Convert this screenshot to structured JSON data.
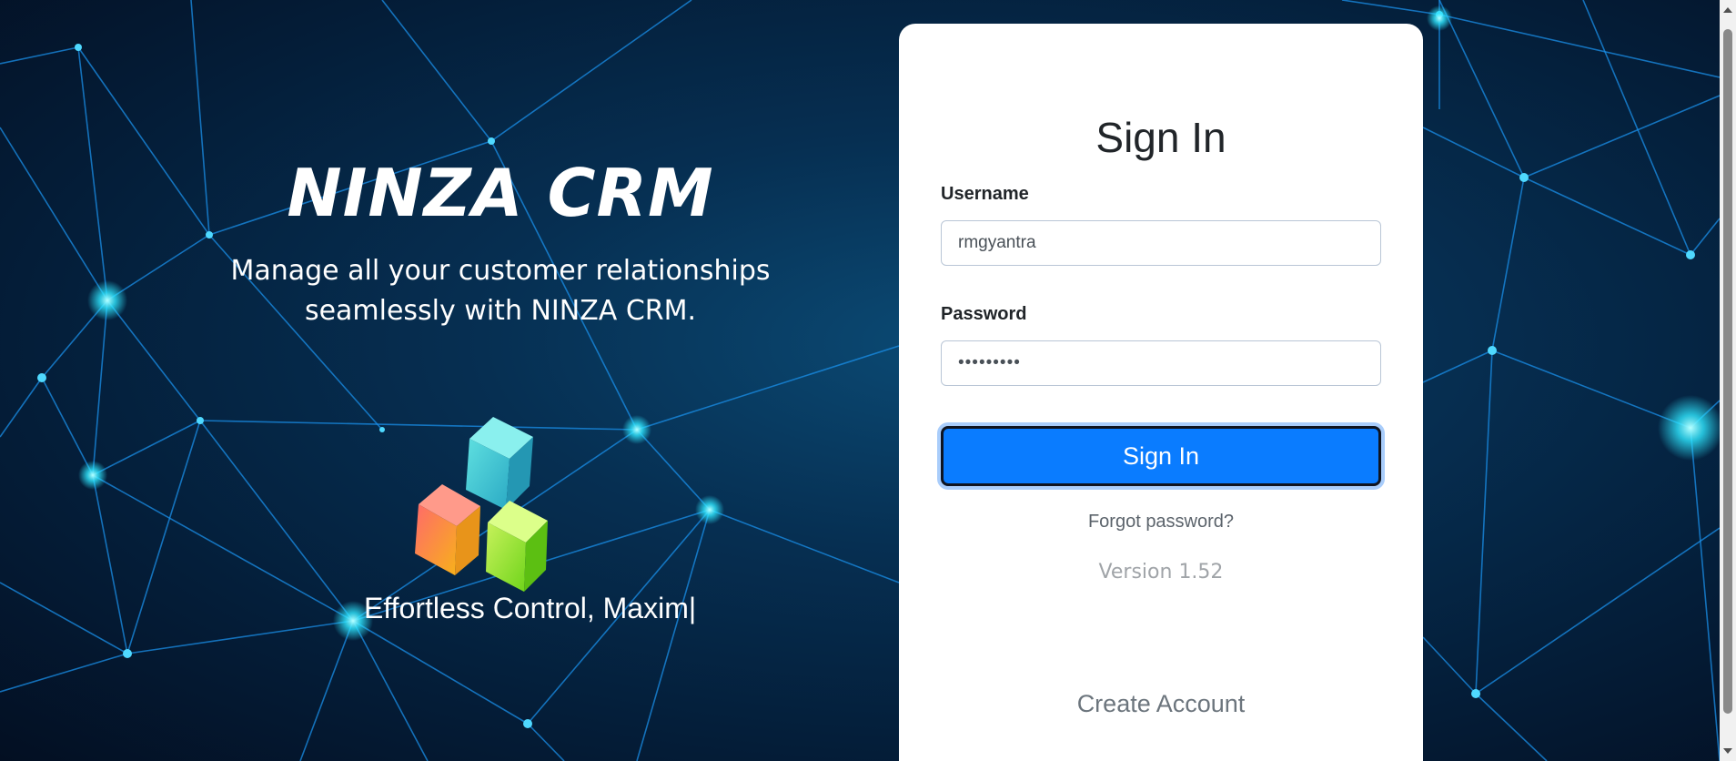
{
  "hero": {
    "title": "NINZA CRM",
    "subtitle_line1": "Manage all your customer relationships",
    "subtitle_line2": "seamlessly with NINZA CRM.",
    "tagline": "Effortless Control, Maxim|",
    "logo_icon": "cubes-logo-icon"
  },
  "login": {
    "title": "Sign In",
    "username_label": "Username",
    "username_value": "rmgyantra",
    "password_label": "Password",
    "password_value": "•••••••••",
    "signin_button": "Sign In",
    "forgot_link": "Forgot password?",
    "version": "Version 1.52",
    "create_account": "Create Account"
  },
  "colors": {
    "primary_button": "#0a7cff",
    "background": "#062f52",
    "accent_node": "#1fe3f5"
  }
}
